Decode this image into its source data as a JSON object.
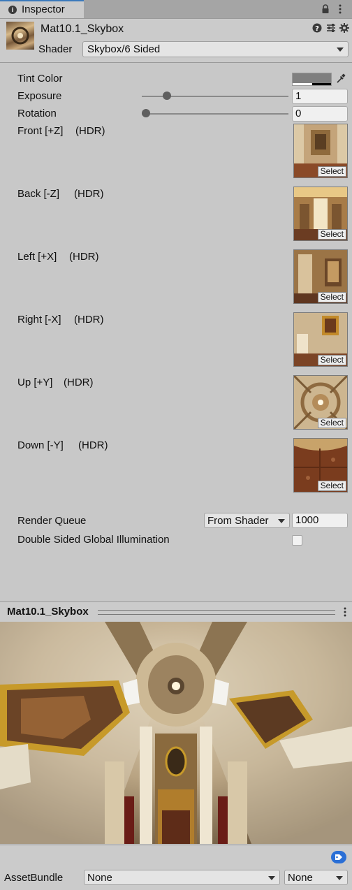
{
  "tab": {
    "title": "Inspector"
  },
  "header": {
    "material_name": "Mat10.1_Skybox",
    "shader_label": "Shader",
    "shader_value": "Skybox/6 Sided"
  },
  "properties": {
    "tint_color_label": "Tint Color",
    "tint_color": "#7f7f7f",
    "exposure_label": "Exposure",
    "exposure_value": "1",
    "exposure_fraction": 0.15,
    "rotation_label": "Rotation",
    "rotation_value": "0",
    "rotation_fraction": 0.0,
    "select_label": "Select",
    "textures": [
      {
        "label": "Front [+Z]",
        "hdr": "(HDR)"
      },
      {
        "label": "Back [-Z]",
        "hdr": "(HDR)"
      },
      {
        "label": "Left [+X]",
        "hdr": "(HDR)"
      },
      {
        "label": "Right [-X]",
        "hdr": "(HDR)"
      },
      {
        "label": "Up [+Y]",
        "hdr": "(HDR)"
      },
      {
        "label": "Down [-Y]",
        "hdr": "(HDR)"
      }
    ],
    "render_queue_label": "Render Queue",
    "render_queue_mode": "From Shader",
    "render_queue_value": "1000",
    "dsgi_label": "Double Sided Global Illumination",
    "dsgi_checked": false
  },
  "preview": {
    "title": "Mat10.1_Skybox"
  },
  "footer": {
    "assetbundle_label": "AssetBundle",
    "bundle_name": "None",
    "bundle_variant": "None"
  },
  "colors": {
    "accent": "#3a79bb",
    "panel": "#c8c8c8",
    "tag": "#2a6fd6"
  }
}
